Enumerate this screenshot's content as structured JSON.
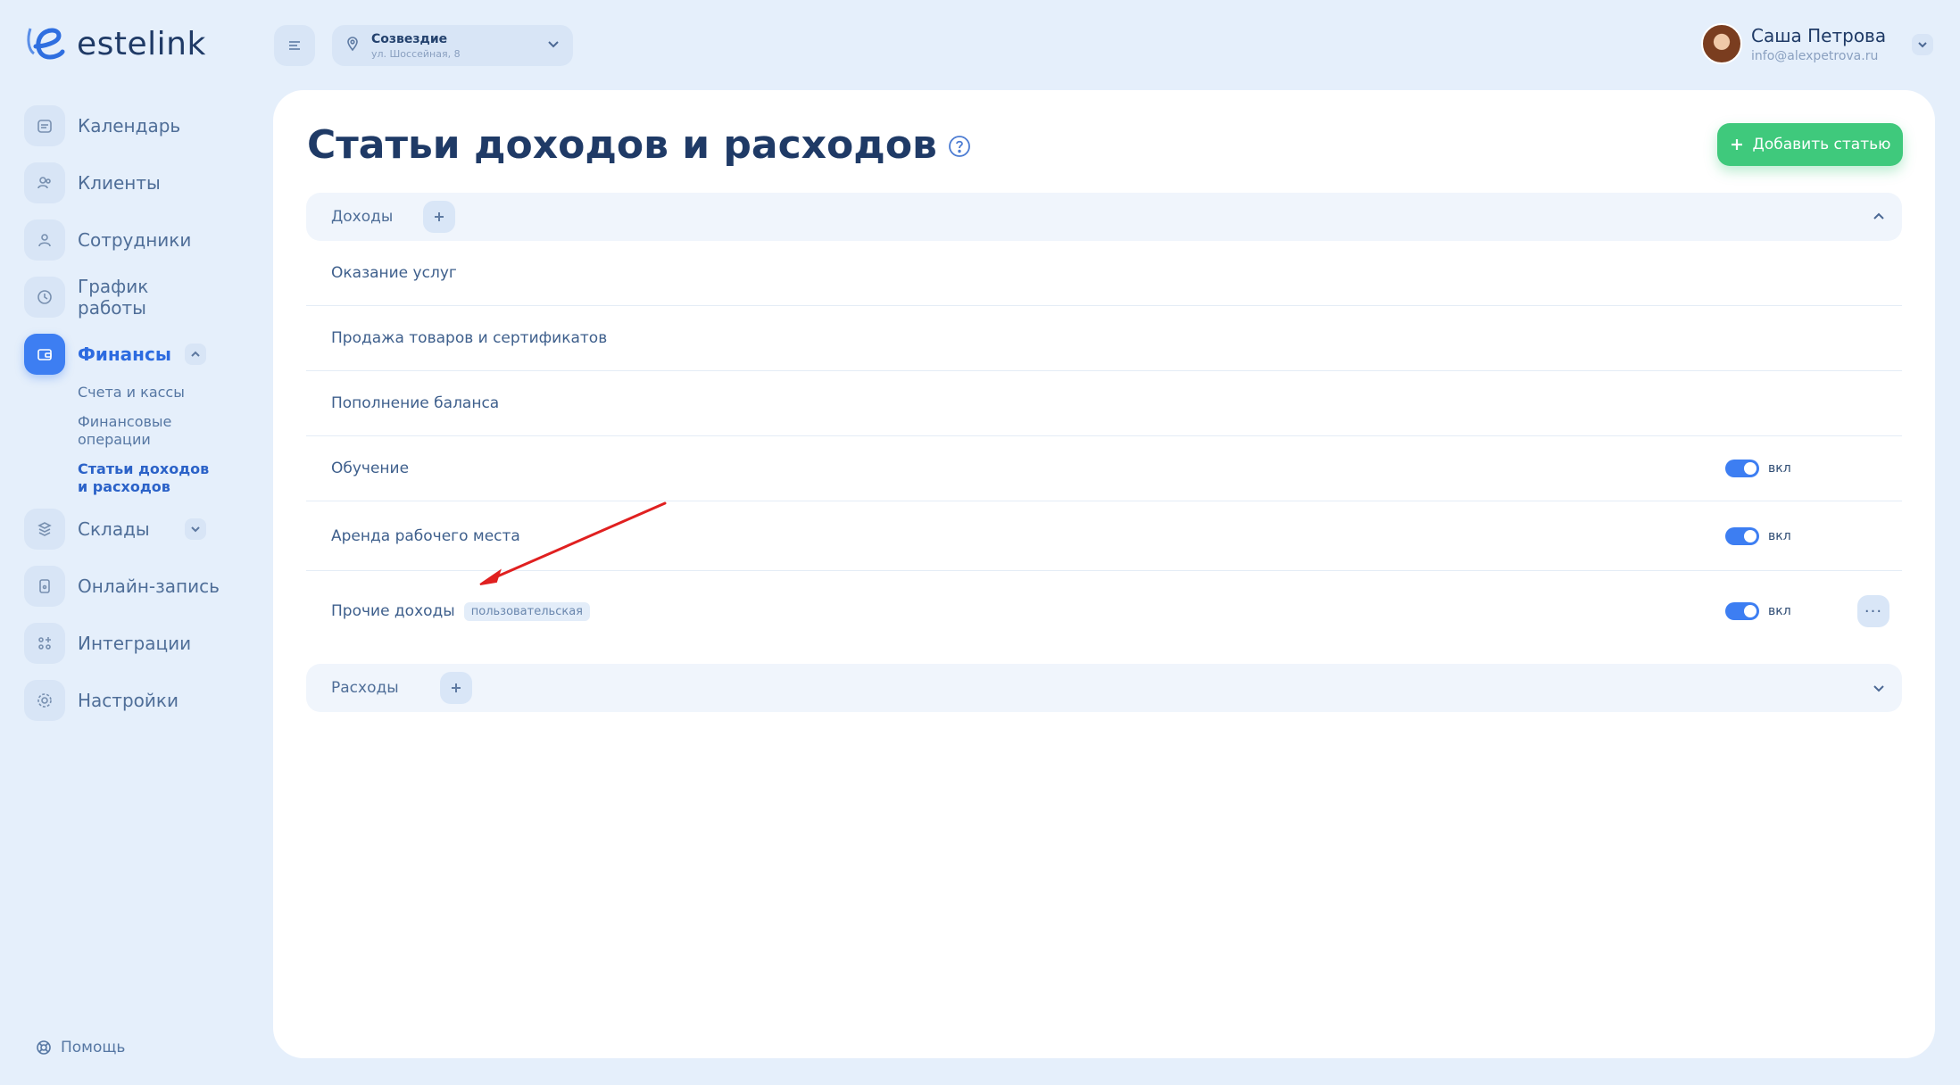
{
  "app": {
    "logo_text": "estelink"
  },
  "sidebar": {
    "items": [
      {
        "label": "Календарь",
        "icon": "calendar-icon"
      },
      {
        "label": "Клиенты",
        "icon": "clients-icon"
      },
      {
        "label": "Сотрудники",
        "icon": "user-icon"
      },
      {
        "label": "График работы",
        "icon": "clock-icon"
      },
      {
        "label": "Финансы",
        "icon": "wallet-icon",
        "active": true,
        "expanded": true
      },
      {
        "label": "Склады",
        "icon": "boxes-icon",
        "collapsed": true
      },
      {
        "label": "Онлайн-запись",
        "icon": "phone-icon"
      },
      {
        "label": "Интеграции",
        "icon": "integrations-icon"
      },
      {
        "label": "Настройки",
        "icon": "gear-icon"
      }
    ],
    "finance_sub": [
      "Счета и кассы",
      "Финансовые операции",
      "Статьи доходов и расходов"
    ],
    "help_label": "Помощь"
  },
  "topbar": {
    "location_name": "Созвездие",
    "location_address": "ул. Шоссейная, 8",
    "user_name": "Саша Петрова",
    "user_email": "info@alexpetrova.ru"
  },
  "main": {
    "title": "Статьи доходов и расходов",
    "add_button": "Добавить статью",
    "income_section": {
      "title": "Доходы",
      "expanded": true,
      "rows": [
        {
          "label": "Оказание услуг"
        },
        {
          "label": "Продажа товаров и сертификатов"
        },
        {
          "label": "Пополнение баланса"
        },
        {
          "label": "Обучение",
          "toggle": "вкл"
        },
        {
          "label": "Аренда рабочего места",
          "toggle": "вкл"
        },
        {
          "label": "Прочие доходы",
          "tag": "пользовательская",
          "toggle": "вкл",
          "more": "···"
        }
      ]
    },
    "expense_section": {
      "title": "Расходы",
      "expanded": false
    }
  },
  "colors": {
    "accent": "#3d7ef2",
    "success": "#3fc97c",
    "background": "#e5effb",
    "annotation": "#e02020"
  }
}
